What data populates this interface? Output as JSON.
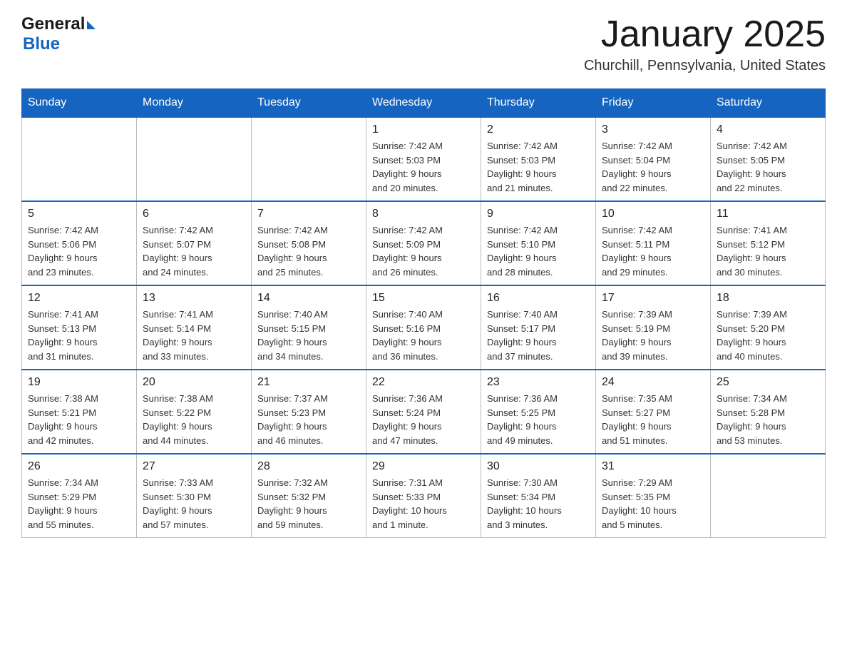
{
  "header": {
    "logo_general": "General",
    "logo_blue": "Blue",
    "month_title": "January 2025",
    "location": "Churchill, Pennsylvania, United States"
  },
  "days_of_week": [
    "Sunday",
    "Monday",
    "Tuesday",
    "Wednesday",
    "Thursday",
    "Friday",
    "Saturday"
  ],
  "weeks": [
    [
      {
        "day": "",
        "info": ""
      },
      {
        "day": "",
        "info": ""
      },
      {
        "day": "",
        "info": ""
      },
      {
        "day": "1",
        "info": "Sunrise: 7:42 AM\nSunset: 5:03 PM\nDaylight: 9 hours\nand 20 minutes."
      },
      {
        "day": "2",
        "info": "Sunrise: 7:42 AM\nSunset: 5:03 PM\nDaylight: 9 hours\nand 21 minutes."
      },
      {
        "day": "3",
        "info": "Sunrise: 7:42 AM\nSunset: 5:04 PM\nDaylight: 9 hours\nand 22 minutes."
      },
      {
        "day": "4",
        "info": "Sunrise: 7:42 AM\nSunset: 5:05 PM\nDaylight: 9 hours\nand 22 minutes."
      }
    ],
    [
      {
        "day": "5",
        "info": "Sunrise: 7:42 AM\nSunset: 5:06 PM\nDaylight: 9 hours\nand 23 minutes."
      },
      {
        "day": "6",
        "info": "Sunrise: 7:42 AM\nSunset: 5:07 PM\nDaylight: 9 hours\nand 24 minutes."
      },
      {
        "day": "7",
        "info": "Sunrise: 7:42 AM\nSunset: 5:08 PM\nDaylight: 9 hours\nand 25 minutes."
      },
      {
        "day": "8",
        "info": "Sunrise: 7:42 AM\nSunset: 5:09 PM\nDaylight: 9 hours\nand 26 minutes."
      },
      {
        "day": "9",
        "info": "Sunrise: 7:42 AM\nSunset: 5:10 PM\nDaylight: 9 hours\nand 28 minutes."
      },
      {
        "day": "10",
        "info": "Sunrise: 7:42 AM\nSunset: 5:11 PM\nDaylight: 9 hours\nand 29 minutes."
      },
      {
        "day": "11",
        "info": "Sunrise: 7:41 AM\nSunset: 5:12 PM\nDaylight: 9 hours\nand 30 minutes."
      }
    ],
    [
      {
        "day": "12",
        "info": "Sunrise: 7:41 AM\nSunset: 5:13 PM\nDaylight: 9 hours\nand 31 minutes."
      },
      {
        "day": "13",
        "info": "Sunrise: 7:41 AM\nSunset: 5:14 PM\nDaylight: 9 hours\nand 33 minutes."
      },
      {
        "day": "14",
        "info": "Sunrise: 7:40 AM\nSunset: 5:15 PM\nDaylight: 9 hours\nand 34 minutes."
      },
      {
        "day": "15",
        "info": "Sunrise: 7:40 AM\nSunset: 5:16 PM\nDaylight: 9 hours\nand 36 minutes."
      },
      {
        "day": "16",
        "info": "Sunrise: 7:40 AM\nSunset: 5:17 PM\nDaylight: 9 hours\nand 37 minutes."
      },
      {
        "day": "17",
        "info": "Sunrise: 7:39 AM\nSunset: 5:19 PM\nDaylight: 9 hours\nand 39 minutes."
      },
      {
        "day": "18",
        "info": "Sunrise: 7:39 AM\nSunset: 5:20 PM\nDaylight: 9 hours\nand 40 minutes."
      }
    ],
    [
      {
        "day": "19",
        "info": "Sunrise: 7:38 AM\nSunset: 5:21 PM\nDaylight: 9 hours\nand 42 minutes."
      },
      {
        "day": "20",
        "info": "Sunrise: 7:38 AM\nSunset: 5:22 PM\nDaylight: 9 hours\nand 44 minutes."
      },
      {
        "day": "21",
        "info": "Sunrise: 7:37 AM\nSunset: 5:23 PM\nDaylight: 9 hours\nand 46 minutes."
      },
      {
        "day": "22",
        "info": "Sunrise: 7:36 AM\nSunset: 5:24 PM\nDaylight: 9 hours\nand 47 minutes."
      },
      {
        "day": "23",
        "info": "Sunrise: 7:36 AM\nSunset: 5:25 PM\nDaylight: 9 hours\nand 49 minutes."
      },
      {
        "day": "24",
        "info": "Sunrise: 7:35 AM\nSunset: 5:27 PM\nDaylight: 9 hours\nand 51 minutes."
      },
      {
        "day": "25",
        "info": "Sunrise: 7:34 AM\nSunset: 5:28 PM\nDaylight: 9 hours\nand 53 minutes."
      }
    ],
    [
      {
        "day": "26",
        "info": "Sunrise: 7:34 AM\nSunset: 5:29 PM\nDaylight: 9 hours\nand 55 minutes."
      },
      {
        "day": "27",
        "info": "Sunrise: 7:33 AM\nSunset: 5:30 PM\nDaylight: 9 hours\nand 57 minutes."
      },
      {
        "day": "28",
        "info": "Sunrise: 7:32 AM\nSunset: 5:32 PM\nDaylight: 9 hours\nand 59 minutes."
      },
      {
        "day": "29",
        "info": "Sunrise: 7:31 AM\nSunset: 5:33 PM\nDaylight: 10 hours\nand 1 minute."
      },
      {
        "day": "30",
        "info": "Sunrise: 7:30 AM\nSunset: 5:34 PM\nDaylight: 10 hours\nand 3 minutes."
      },
      {
        "day": "31",
        "info": "Sunrise: 7:29 AM\nSunset: 5:35 PM\nDaylight: 10 hours\nand 5 minutes."
      },
      {
        "day": "",
        "info": ""
      }
    ]
  ]
}
